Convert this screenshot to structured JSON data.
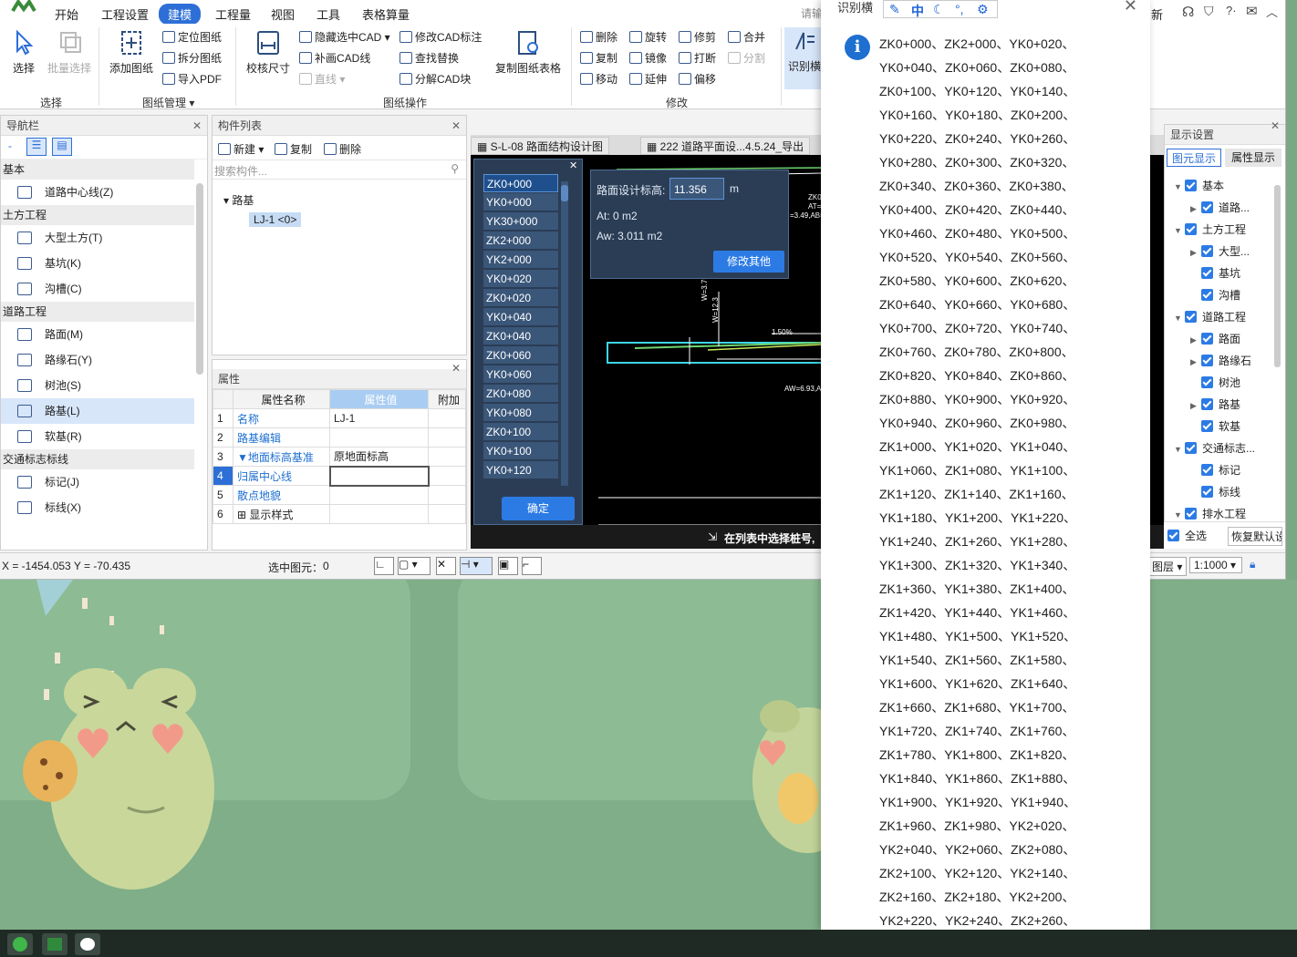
{
  "menubar": {
    "items": [
      "开始",
      "工程设置",
      "建模",
      "工程量",
      "视图",
      "工具",
      "表格算量"
    ],
    "active_index": 2,
    "search_placeholder": "请输",
    "right_text": "新"
  },
  "ribbon": {
    "select": {
      "select_label": "选择",
      "batch_label": "批量选择",
      "group_label": "选择"
    },
    "drawing_mgmt": {
      "add_label": "添加图纸",
      "locate_label": "定位图纸",
      "split_label": "拆分图纸",
      "export_pdf_label": "导入PDF",
      "group_label": "图纸管理"
    },
    "drawing_ops": {
      "check_size_label": "校核尺寸",
      "hide_cad_label": "隐藏选中CAD",
      "modify_cad_label": "修改CAD标注",
      "fill_cad_label": "补画CAD线",
      "find_replace_label": "查找替换",
      "line_label": "直线",
      "decompose_label": "分解CAD块",
      "copy_table_label": "复制图纸表格",
      "group_label": "图纸操作"
    },
    "modify": {
      "delete_label": "删除",
      "rotate_label": "旋转",
      "trim_label": "修剪",
      "merge_label": "合并",
      "copy_label": "复制",
      "mirror_label": "镜像",
      "break_label": "打断",
      "split_label": "分割",
      "move_label": "移动",
      "extend_label": "延伸",
      "offset_label": "偏移",
      "group_label": "修改"
    },
    "recognize": {
      "label": "识别横",
      "break_label": "断面"
    }
  },
  "nav": {
    "title": "导航栏",
    "groups": [
      {
        "name": "基本",
        "items": [
          "道路中心线(Z)"
        ]
      },
      {
        "name": "土方工程",
        "items": [
          "大型土方(T)",
          "基坑(K)",
          "沟槽(C)"
        ]
      },
      {
        "name": "道路工程",
        "items": [
          "路面(M)",
          "路缘石(Y)",
          "树池(S)",
          "路基(L)",
          "软基(R)"
        ]
      },
      {
        "name": "交通标志标线",
        "items": [
          "标记(J)",
          "标线(X)"
        ]
      }
    ],
    "selected_item": "路基(L)"
  },
  "components": {
    "title": "构件列表",
    "new_label": "新建",
    "copy_label": "复制",
    "delete_label": "删除",
    "search_placeholder": "搜索构件...",
    "tree_root": "路基",
    "tree_child": "LJ-1 <0>"
  },
  "properties": {
    "title": "属性",
    "headers": [
      "属性名称",
      "属性值",
      "附加"
    ],
    "rows": [
      {
        "no": "1",
        "name": "名称",
        "value": "LJ-1"
      },
      {
        "no": "2",
        "name": "路基编辑",
        "value": ""
      },
      {
        "no": "3",
        "name": "▼地面标高基准",
        "value": "原地面标高"
      },
      {
        "no": "4",
        "name": "归属中心线",
        "value": ""
      },
      {
        "no": "5",
        "name": "散点地貌",
        "value": ""
      },
      {
        "no": "6",
        "name": "显示样式",
        "value": ""
      }
    ]
  },
  "drawing_tabs": [
    "S-L-08 路面结构设计图",
    "222 道路平面设...4.5.24_导出"
  ],
  "station_list": {
    "items": [
      "ZK0+000",
      "YK0+000",
      "YK30+000",
      "ZK2+000",
      "YK2+000",
      "YK0+020",
      "ZK0+020",
      "YK0+040",
      "ZK0+040",
      "ZK0+060",
      "YK0+060",
      "ZK0+080",
      "YK0+080",
      "ZK0+100",
      "YK0+100",
      "YK0+120"
    ],
    "selected_index": 0,
    "ok_label": "确定"
  },
  "elevation_dialog": {
    "label": "路面设计标高:",
    "value": "11.356",
    "unit": "m",
    "at": "At: 0 m2",
    "aw": "Aw: 3.011 m2",
    "button": "修改其他"
  },
  "canvas_hint": "在列表中选择桩号,",
  "cad_texts": {
    "t1": "1.50%",
    "t2": "ZK0+",
    "t3": "AT=",
    "t4": "=3.49,AB=",
    "t5": "AW=6.93,AB=",
    "t6": "W=3.75",
    "t7": "W=12.3"
  },
  "statusbar": {
    "coords": "X = -1454.053 Y = -70.435",
    "selected": "选中图元：",
    "selected_count": "0",
    "layer_label": "图层",
    "scale": "1:1000"
  },
  "display_settings": {
    "title": "显示设置",
    "tabs": [
      "图元显示",
      "属性显示"
    ],
    "tree": [
      {
        "label": "基本",
        "level": 0,
        "expand": "▼"
      },
      {
        "label": "道路...",
        "level": 1,
        "expand": "▶"
      },
      {
        "label": "土方工程",
        "level": 0,
        "expand": "▼"
      },
      {
        "label": "大型...",
        "level": 1,
        "expand": "▶"
      },
      {
        "label": "基坑",
        "level": 1,
        "expand": ""
      },
      {
        "label": "沟槽",
        "level": 1,
        "expand": ""
      },
      {
        "label": "道路工程",
        "level": 0,
        "expand": "▼"
      },
      {
        "label": "路面",
        "level": 1,
        "expand": "▶"
      },
      {
        "label": "路缘石",
        "level": 1,
        "expand": "▶"
      },
      {
        "label": "树池",
        "level": 1,
        "expand": ""
      },
      {
        "label": "路基",
        "level": 1,
        "expand": "▶"
      },
      {
        "label": "软基",
        "level": 1,
        "expand": ""
      },
      {
        "label": "交通标志...",
        "level": 0,
        "expand": "▼"
      },
      {
        "label": "标记",
        "level": 1,
        "expand": ""
      },
      {
        "label": "标线",
        "level": 1,
        "expand": ""
      },
      {
        "label": "排水工程",
        "level": 0,
        "expand": "▼"
      }
    ],
    "select_all": "全选",
    "restore_default": "恢复默认设置"
  },
  "overlay": {
    "title": "识别横",
    "toolbar": [
      "中"
    ],
    "lines": [
      "ZK0+000、ZK2+000、YK0+020、",
      "YK0+040、ZK0+060、ZK0+080、",
      "ZK0+100、YK0+120、YK0+140、",
      "YK0+160、YK0+180、ZK0+200、",
      "YK0+220、ZK0+240、YK0+260、",
      "YK0+280、ZK0+300、ZK0+320、",
      "ZK0+340、ZK0+360、ZK0+380、",
      "YK0+400、ZK0+420、ZK0+440、",
      "YK0+460、ZK0+480、YK0+500、",
      "YK0+520、YK0+540、ZK0+560、",
      "ZK0+580、YK0+600、ZK0+620、",
      "ZK0+640、YK0+660、YK0+680、",
      "YK0+700、ZK0+720、YK0+740、",
      "ZK0+760、ZK0+780、ZK0+800、",
      "ZK0+820、YK0+840、ZK0+860、",
      "ZK0+880、YK0+900、YK0+920、",
      "YK0+940、ZK0+960、ZK0+980、",
      "ZK1+000、YK1+020、YK1+040、",
      "YK1+060、ZK1+080、YK1+100、",
      "ZK1+120、ZK1+140、ZK1+160、",
      "YK1+180、YK1+200、YK1+220、",
      "YK1+240、ZK1+260、YK1+280、",
      "YK1+300、ZK1+320、YK1+340、",
      "ZK1+360、YK1+380、ZK1+400、",
      "ZK1+420、YK1+440、YK1+460、",
      "YK1+480、YK1+500、YK1+520、",
      "YK1+540、ZK1+560、ZK1+580、",
      "YK1+600、YK1+620、ZK1+640、",
      "ZK1+660、ZK1+680、YK1+700、",
      "YK1+720、ZK1+740、ZK1+760、",
      "ZK1+780、YK1+800、ZK1+820、",
      "YK1+840、YK1+860、ZK1+880、",
      "YK1+900、YK1+920、YK1+940、",
      "ZK1+960、ZK1+980、YK2+020、",
      "YK2+040、YK2+060、ZK2+080、",
      "ZK2+100、YK2+120、YK2+140、",
      "ZK2+160、ZK2+180、YK2+200、",
      "YK2+220、YK2+240、ZK2+260、"
    ]
  }
}
